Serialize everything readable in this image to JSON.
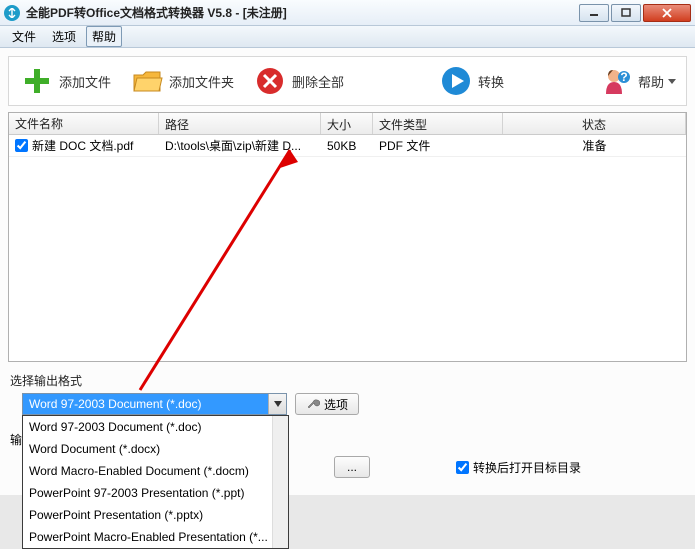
{
  "title": "全能PDF转Office文档格式转换器 V5.8  -  [未注册]",
  "menubar": {
    "file": "文件",
    "options": "选项",
    "help": "帮助"
  },
  "toolbar": {
    "add_file": "添加文件",
    "add_folder": "添加文件夹",
    "delete_all": "删除全部",
    "convert": "转换",
    "help": "帮助"
  },
  "grid": {
    "headers": {
      "name": "文件名称",
      "path": "路径",
      "size": "大小",
      "type": "文件类型",
      "status": "状态"
    },
    "rows": [
      {
        "checked": true,
        "name": "新建 DOC 文档.pdf",
        "path": "D:\\tools\\桌面\\zip\\新建 D...",
        "size": "50KB",
        "type": "PDF 文件",
        "status": "准备"
      }
    ]
  },
  "section_output_format": "选择输出格式",
  "combo": {
    "selected": "Word 97-2003 Document (*.doc)",
    "options": [
      "Word 97-2003 Document (*.doc)",
      "Word Document (*.docx)",
      "Word Macro-Enabled Document (*.docm)",
      "PowerPoint 97-2003 Presentation (*.ppt)",
      "PowerPoint Presentation (*.pptx)",
      "PowerPoint Macro-Enabled Presentation (*..."
    ]
  },
  "options_button": "选项",
  "output_label": "输出",
  "browse_button": "...",
  "open_after_convert": "转换后打开目标目录",
  "open_after_checked": true
}
